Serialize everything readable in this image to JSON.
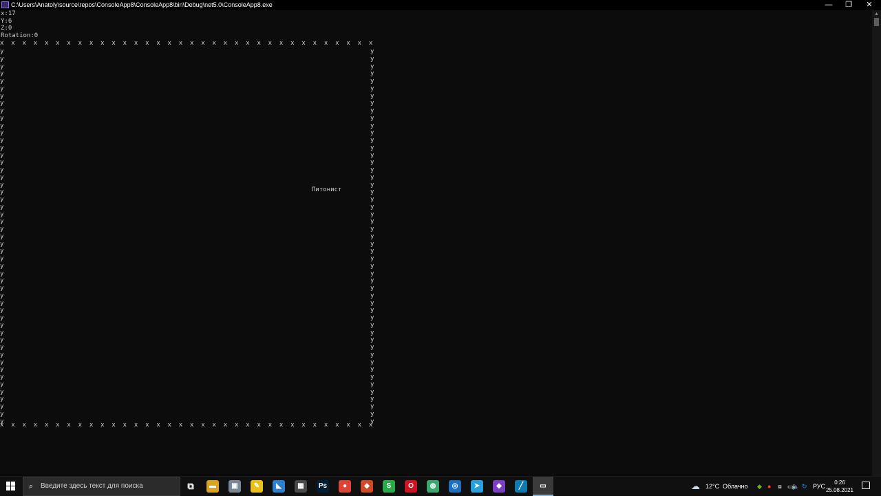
{
  "window": {
    "title": "C:\\Users\\Anatoly\\source\\repos\\ConsoleApp8\\ConsoleApp8\\bin\\Debug\\net5.0\\ConsoleApp8.exe",
    "minimize": "—",
    "restore": "❐",
    "close": "✕"
  },
  "console": {
    "x_line": "x:17",
    "y_line": "Y:6",
    "z_line": "Z:0",
    "rotation_line": "Rotation:0",
    "border_top": "x x x x x x x x x x x x x x x x x x x x x x x x x x x x x x x x x x x x x x x x x x x x x x x x x x x x",
    "border_bottom": "x x x x x x x x x x x x x x x x x x x x x x x x x x x x x x x x x x x x x x x x x x x x x x x x x x x x",
    "border_left": "y\ny\ny\ny\ny\ny\ny\ny\ny\ny\ny\ny\ny\ny\ny\ny\ny\ny\ny\ny\ny\ny\ny\ny\ny\ny\ny\ny\ny\ny\ny\ny\ny\ny\ny\ny\ny\ny\ny\ny\ny\ny\ny\ny\ny\ny\ny\ny\ny\ny\ny",
    "border_right": "y\ny\ny\ny\ny\ny\ny\ny\ny\ny\ny\ny\ny\ny\ny\ny\ny\ny\ny\ny\ny\ny\ny\ny\ny\ny\ny\ny\ny\ny\ny\ny\ny\ny\ny\ny\ny\ny\ny\ny\ny\ny\ny\ny\ny\ny\ny\ny\ny\ny\ny",
    "player_label": "Питонист"
  },
  "taskbar": {
    "search_placeholder": "Введите здесь текст для поиска",
    "apps": [
      {
        "name": "task-view",
        "glyph": "⧉",
        "color": "transparent"
      },
      {
        "name": "file-explorer",
        "glyph": "▬",
        "color": "#d9a520"
      },
      {
        "name": "app-grey",
        "glyph": "▣",
        "color": "#7a8896"
      },
      {
        "name": "sticky-app",
        "glyph": "✎",
        "color": "#e8c21a"
      },
      {
        "name": "blue-app",
        "glyph": "◣",
        "color": "#2f7fd0"
      },
      {
        "name": "calculator",
        "glyph": "▦",
        "color": "#4a4a4a"
      },
      {
        "name": "photoshop",
        "glyph": "Ps",
        "color": "#001e36"
      },
      {
        "name": "chrome",
        "glyph": "●",
        "color": "#db4437"
      },
      {
        "name": "red-app",
        "glyph": "◆",
        "color": "#d04a2a"
      },
      {
        "name": "skype-like",
        "glyph": "S",
        "color": "#2aa84a"
      },
      {
        "name": "opera",
        "glyph": "O",
        "color": "#cc1424"
      },
      {
        "name": "green-app",
        "glyph": "◍",
        "color": "#3aa870"
      },
      {
        "name": "swirl-app",
        "glyph": "◎",
        "color": "#1f6fc0"
      },
      {
        "name": "telegram",
        "glyph": "➤",
        "color": "#2aa0d8"
      },
      {
        "name": "visual-studio",
        "glyph": "◆",
        "color": "#7b3fc4"
      },
      {
        "name": "vs-code",
        "glyph": "╱",
        "color": "#107ab0"
      },
      {
        "name": "console",
        "glyph": "▭",
        "color": "#4a3a7a",
        "active": true
      }
    ],
    "weather_temp": "12°C",
    "weather_text": "Облачно",
    "language": "РУС",
    "time": "0:26",
    "date": "25.08.2021"
  },
  "colors": {
    "console_bg": "#0c0c0c",
    "console_fg": "#cccccc",
    "taskbar_bg": "#101010",
    "accent": "#76b9ed"
  }
}
